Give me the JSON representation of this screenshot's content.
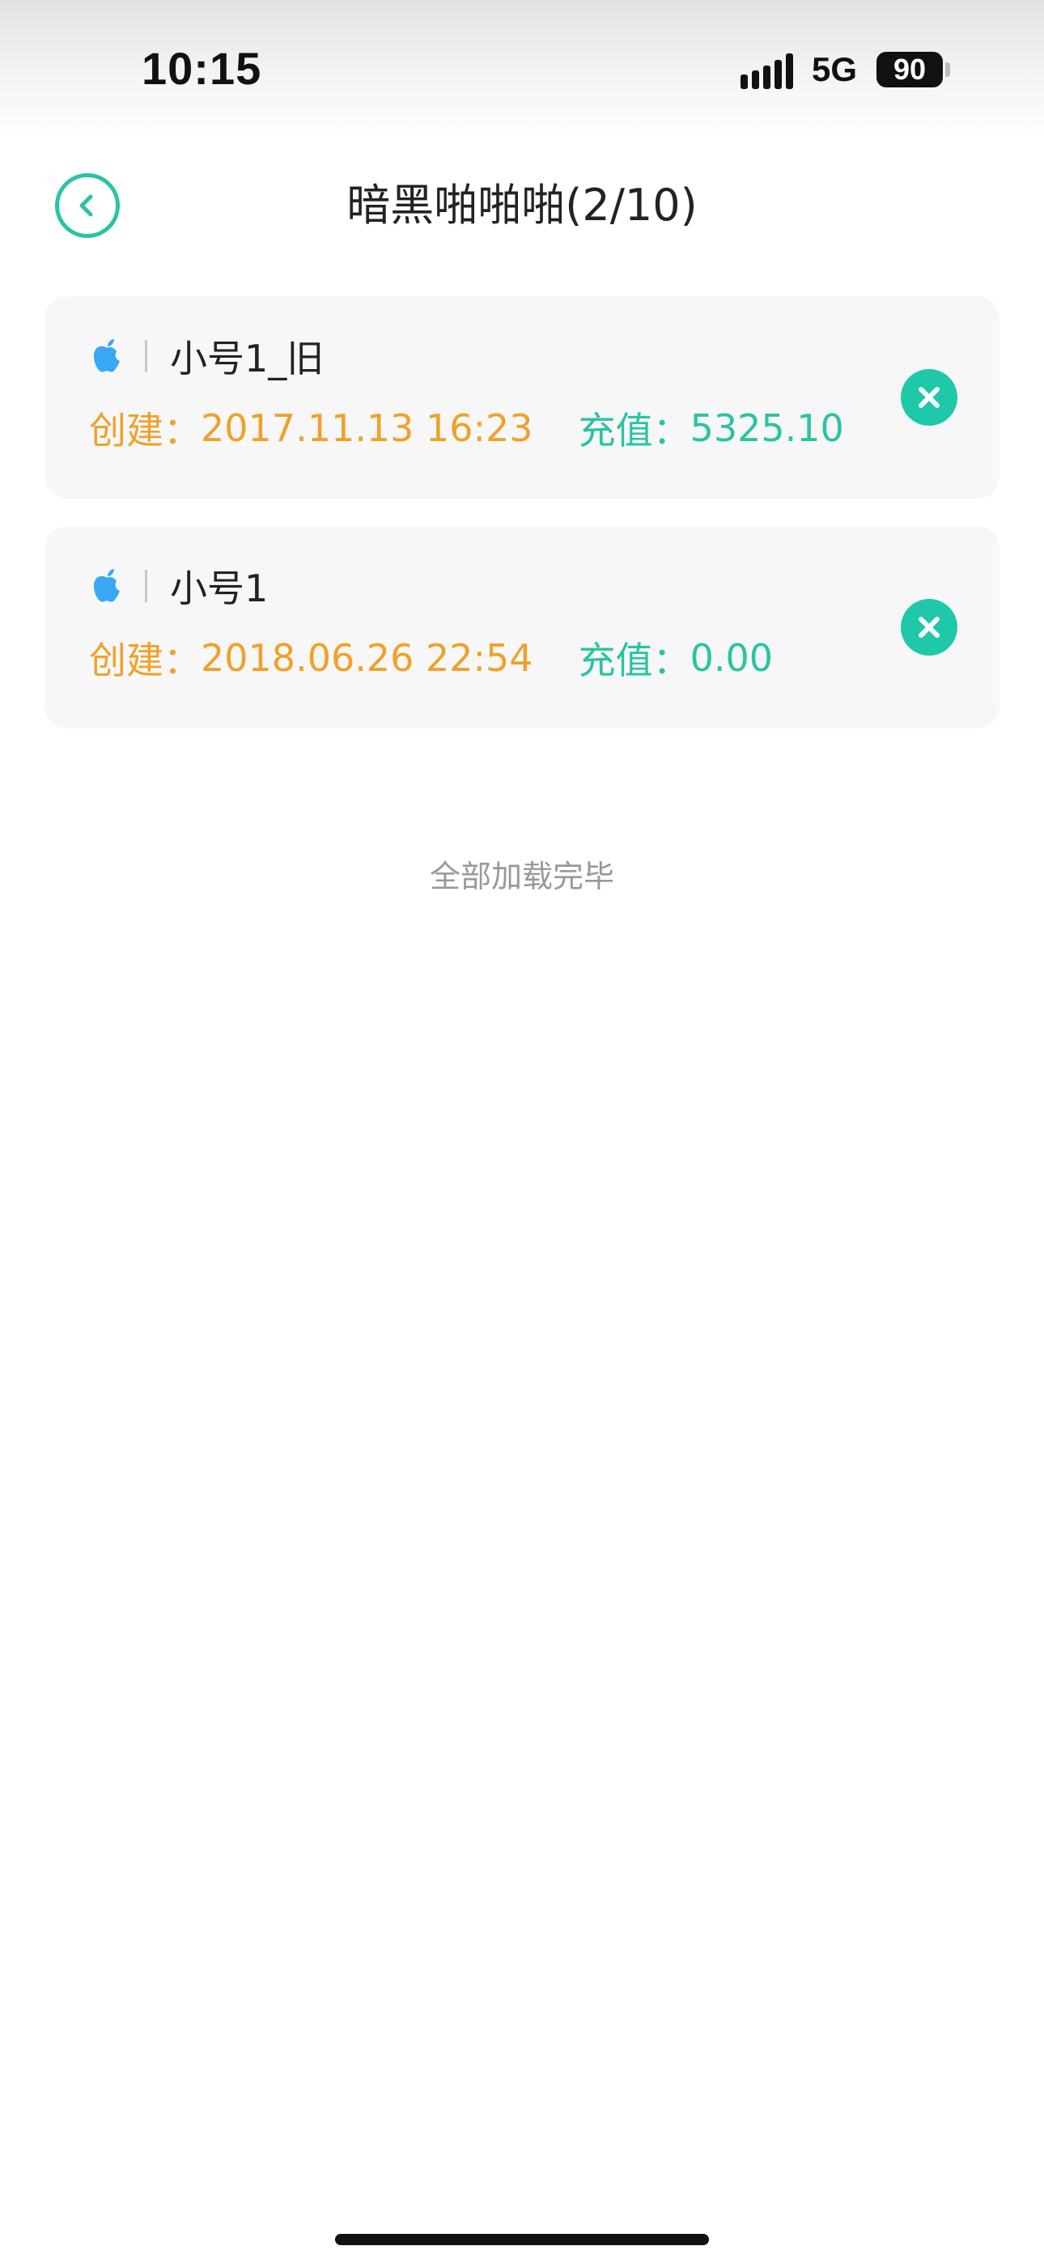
{
  "status_bar": {
    "time": "10:15",
    "network": "5G",
    "battery": "90"
  },
  "nav": {
    "title": "暗黑啪啪啪(2/10)"
  },
  "accounts": [
    {
      "name": "小号1_旧",
      "created_label": "创建：",
      "created": "2017.11.13 16:23",
      "recharge_label": "充值：",
      "recharge": "5325.10"
    },
    {
      "name": "小号1",
      "created_label": "创建：",
      "created": "2018.06.26 22:54",
      "recharge_label": "充值：",
      "recharge": "0.00"
    }
  ],
  "footer": {
    "load_finished": "全部加载完毕"
  },
  "colors": {
    "accent": "#2ac3a5",
    "created": "#f0a12a",
    "recharge": "#2ac3a5",
    "apple_icon": "#3aa7f5"
  },
  "icons": {
    "back": "chevron-left-icon",
    "platform": "apple-icon",
    "delete": "close-icon"
  }
}
